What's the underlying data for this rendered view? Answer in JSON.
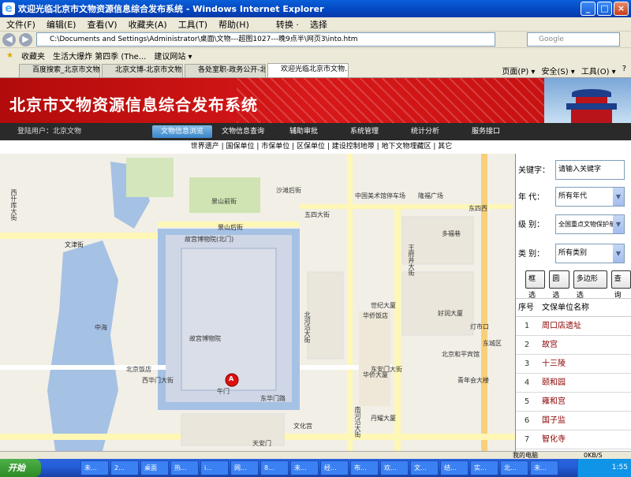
{
  "window": {
    "title": "欢迎光临北京市文物资源信息综合发布系统 - Windows Internet Explorer",
    "min": "_",
    "max": "□",
    "close": "×"
  },
  "menu": [
    "文件(F)",
    "编辑(E)",
    "查看(V)",
    "收藏夹(A)",
    "工具(T)",
    "帮助(H)",
    "转换 · ",
    "选择"
  ],
  "address": {
    "url": "C:\\Documents and Settings\\Administrator\\桌面\\文物---超图1027---晚9点半\\网页3\\into.htm",
    "search_placeholder": "Google"
  },
  "favorites": {
    "label": "收藏夹",
    "items": [
      "生活大爆炸 第四季 (The...",
      "建议网站 ▾"
    ]
  },
  "tabs": [
    "百度搜索_北京市文物局",
    "北京文博-北京市文物局...",
    "各处室职-政务公开-北京...",
    "欢迎光临北京市文物..."
  ],
  "tabtools": [
    "页面(P) ▾",
    "安全(S) ▾",
    "工具(O) ▾",
    "?"
  ],
  "app": {
    "title": "北京市文物资源信息综合发布系统",
    "user": "登陆用户：北京文物",
    "nav": [
      "文物信息浏览",
      "文物信息查询",
      "辅助审批",
      "系统管理",
      "统计分析",
      "服务接口"
    ],
    "subnav": "世界遗产 | 国保单位 | 市保单位 | 区保单位 | 建设控制地带 | 地下文物埋藏区 | 其它"
  },
  "map": {
    "labels": [
      "文津街",
      "景山后街",
      "景山前街",
      "故宫博物院",
      "故宫博物院(北门)",
      "中海",
      "北京饭店",
      "西华门大街",
      "东华门路",
      "午门",
      "沙滩后街",
      "五四大街",
      "华侨大厦",
      "多福巷",
      "东四西",
      "中国美术馆停车场",
      "隆福广场",
      "东城区",
      "东安门大街",
      "王府井大街",
      "南河沿大街",
      "北河沿大街",
      "灯市口",
      "北京和平宾馆",
      "文化宫",
      "天安门",
      "丹耀大厦",
      "青年会大楼",
      "好润大厦",
      "世纪大厦",
      "华侨饭店",
      "西什库大街"
    ],
    "marker": "A"
  },
  "filter": {
    "keyword_label": "关键字：",
    "keyword_placeholder": "请输入关键字",
    "era_label": "年  代：",
    "era_value": "所有年代",
    "level_label": "级  别：",
    "level_value": "全国重点文物保护单位",
    "type_label": "类  别：",
    "type_value": "所有类别",
    "buttons": [
      "框选",
      "圆选",
      "多边形选",
      "查询"
    ]
  },
  "table": {
    "headers": [
      "序号",
      "文保单位名称"
    ],
    "rows": [
      [
        "1",
        "周口店遗址"
      ],
      [
        "2",
        "故宫"
      ],
      [
        "3",
        "十三陵"
      ],
      [
        "4",
        "颐和园"
      ],
      [
        "5",
        "雍和宫"
      ],
      [
        "6",
        "国子监"
      ],
      [
        "7",
        "智化寺"
      ]
    ]
  },
  "status": {
    "text": "我的电脑",
    "zoom": "0KB/S"
  },
  "taskbar": {
    "start": "开始",
    "items": [
      "未...",
      "2...",
      "桌面",
      "热...",
      "i...",
      "网...",
      "8...",
      "未...",
      "经...",
      "布...",
      "欢...",
      "文...",
      "结...",
      "实...",
      "北...",
      "未..."
    ],
    "time": "1:55"
  }
}
